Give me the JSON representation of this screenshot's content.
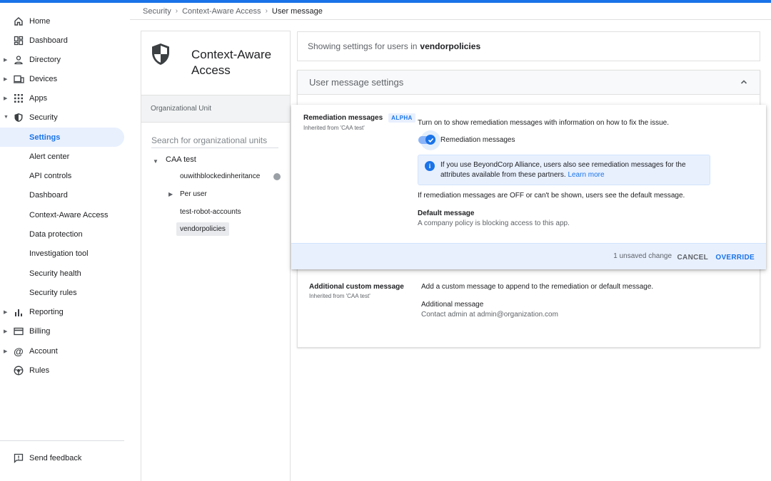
{
  "breadcrumb": [
    "Security",
    "Context-Aware Access",
    "User message"
  ],
  "nav": {
    "items": [
      {
        "label": "Home",
        "icon": "home-icon",
        "caret": false
      },
      {
        "label": "Dashboard",
        "icon": "dashboard-icon",
        "caret": false
      },
      {
        "label": "Directory",
        "icon": "person-icon",
        "caret": true
      },
      {
        "label": "Devices",
        "icon": "devices-icon",
        "caret": true
      },
      {
        "label": "Apps",
        "icon": "apps-grid-icon",
        "caret": true
      },
      {
        "label": "Security",
        "icon": "shield-icon",
        "caret": true,
        "expanded": true
      },
      {
        "label": "Settings",
        "sub": true,
        "active": true
      },
      {
        "label": "Alert center",
        "sub": true
      },
      {
        "label": "API controls",
        "sub": true
      },
      {
        "label": "Dashboard",
        "sub": true
      },
      {
        "label": "Context-Aware Access",
        "sub": true
      },
      {
        "label": "Data protection",
        "sub": true
      },
      {
        "label": "Investigation tool",
        "sub": true
      },
      {
        "label": "Security health",
        "sub": true
      },
      {
        "label": "Security rules",
        "sub": true
      },
      {
        "label": "Reporting",
        "icon": "bar-chart-icon",
        "caret": true
      },
      {
        "label": "Billing",
        "icon": "credit-card-icon",
        "caret": true
      },
      {
        "label": "Account",
        "icon": "at-sign-icon",
        "caret": true
      },
      {
        "label": "Rules",
        "icon": "rules-icon",
        "caret": false
      }
    ],
    "feedback": "Send feedback"
  },
  "ou": {
    "title": "Context-Aware Access",
    "label": "Organizational Unit",
    "search_placeholder": "Search for organizational units",
    "tree": {
      "root": "CAA test",
      "child1": "ouwithblockedinheritance",
      "child2": "Per user",
      "child3": "test-robot-accounts",
      "child4": "vendorpolicies"
    }
  },
  "main": {
    "showing_prefix": "Showing settings for users in",
    "showing_ou": "vendorpolicies",
    "section_title": "User message settings",
    "remediation": {
      "title": "Remediation messages",
      "badge": "ALPHA",
      "inherited": "Inherited from 'CAA test'",
      "description": "Turn on to show remediation messages with information on how to fix the issue.",
      "toggle_label": "Remediation messages",
      "toggle_on": true,
      "info_text": "If you use BeyondCorp Alliance, users also see remediation messages for the attributes available from these partners.",
      "info_link": "Learn more",
      "off_note": "If remediation messages are OFF or can't be shown, users see the default message.",
      "default_title": "Default message",
      "default_value": "A company policy is blocking access to this app.",
      "unsaved": "1 unsaved change",
      "cancel": "CANCEL",
      "override": "OVERRIDE"
    },
    "additional": {
      "title": "Additional custom message",
      "inherited": "Inherited from 'CAA test'",
      "description": "Add a custom message to append to the remediation or default message.",
      "label": "Additional message",
      "value": "Contact admin at admin@organization.com"
    }
  },
  "colors": {
    "accent": "#1a73e8",
    "active_bg": "#e8f0fe",
    "footer_bg": "#e8f0fe"
  }
}
